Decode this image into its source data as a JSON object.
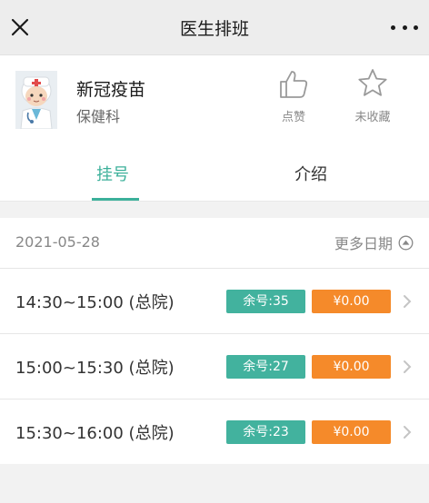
{
  "nav": {
    "title": "医生排班"
  },
  "doctor": {
    "name": "新冠疫苗",
    "department": "保健科"
  },
  "actions": {
    "like_label": "点赞",
    "favorite_label": "未收藏"
  },
  "tabs": [
    {
      "label": "挂号",
      "active": true
    },
    {
      "label": "介绍",
      "active": false
    }
  ],
  "schedule": {
    "date": "2021-05-28",
    "more_dates_label": "更多日期",
    "slots": [
      {
        "time": "14:30~15:00 (总院)",
        "remaining": "余号:35",
        "price": "¥0.00"
      },
      {
        "time": "15:00~15:30 (总院)",
        "remaining": "余号:27",
        "price": "¥0.00"
      },
      {
        "time": "15:30~16:00 (总院)",
        "remaining": "余号:23",
        "price": "¥0.00"
      }
    ]
  },
  "colors": {
    "accent": "#3bb09a",
    "remaining_badge": "#42b29e",
    "price_badge": "#f58a2a"
  },
  "icons": [
    "close-icon",
    "more-icon",
    "doctor-avatar",
    "thumbs-up-icon",
    "star-icon",
    "chevron-up-circle-icon",
    "chevron-right-icon"
  ]
}
